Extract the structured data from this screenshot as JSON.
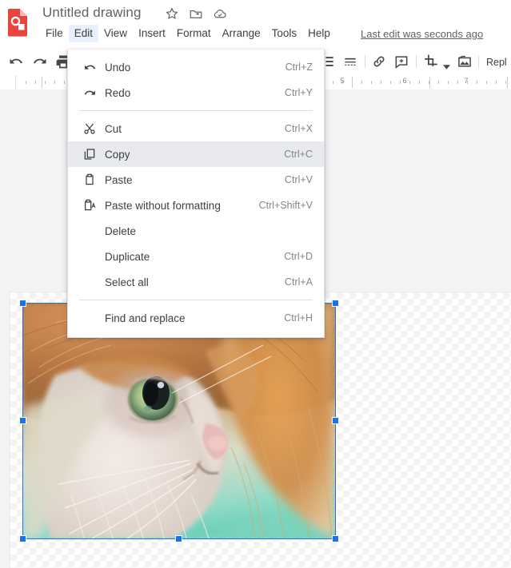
{
  "app": {
    "logo_icon": "google-drawings-logo",
    "logo_color": "#e8453c"
  },
  "header": {
    "doc_title": "Untitled drawing",
    "title_icons": [
      {
        "name": "star-icon",
        "label": "Star"
      },
      {
        "name": "move-to-folder-icon",
        "label": "Move to folder"
      },
      {
        "name": "cloud-saved-icon",
        "label": "Saved to Drive"
      }
    ],
    "menus": [
      {
        "label": "File",
        "active": false
      },
      {
        "label": "Edit",
        "active": true
      },
      {
        "label": "View",
        "active": false
      },
      {
        "label": "Insert",
        "active": false
      },
      {
        "label": "Format",
        "active": false
      },
      {
        "label": "Arrange",
        "active": false
      },
      {
        "label": "Tools",
        "active": false
      },
      {
        "label": "Help",
        "active": false
      }
    ],
    "last_edit": "Last edit was seconds ago"
  },
  "toolbar": {
    "items": [
      {
        "name": "undo-icon",
        "label": "Undo"
      },
      {
        "name": "redo-icon",
        "label": "Redo"
      },
      {
        "name": "print-icon",
        "label": "Print"
      },
      {
        "name": "list-icon",
        "label": "List options"
      },
      {
        "name": "line-dash-icon",
        "label": "Line dash"
      },
      {
        "name": "link-icon",
        "label": "Insert link"
      },
      {
        "name": "comment-icon",
        "label": "Add comment"
      },
      {
        "name": "crop-icon",
        "label": "Crop image"
      },
      {
        "name": "crop-dropdown-caret",
        "label": "Crop options"
      },
      {
        "name": "replace-image-icon",
        "label": "Replace image"
      }
    ],
    "replace_text": "Repl"
  },
  "ruler": {
    "unit_labels": [
      "5",
      "6",
      "7"
    ]
  },
  "edit_menu": {
    "groups": [
      {
        "items": [
          {
            "icon": "undo-icon",
            "label": "Undo",
            "accel": "Ctrl+Z",
            "highlighted": false
          },
          {
            "icon": "redo-icon",
            "label": "Redo",
            "accel": "Ctrl+Y",
            "highlighted": false
          }
        ]
      },
      {
        "items": [
          {
            "icon": "cut-icon",
            "label": "Cut",
            "accel": "Ctrl+X",
            "highlighted": false
          },
          {
            "icon": "copy-icon",
            "label": "Copy",
            "accel": "Ctrl+C",
            "highlighted": true
          },
          {
            "icon": "paste-icon",
            "label": "Paste",
            "accel": "Ctrl+V",
            "highlighted": false
          },
          {
            "icon": "paste-plain-icon",
            "label": "Paste without formatting",
            "accel": "Ctrl+Shift+V",
            "highlighted": false
          },
          {
            "icon": "none",
            "label": "Delete",
            "accel": "",
            "highlighted": false
          },
          {
            "icon": "none",
            "label": "Duplicate",
            "accel": "Ctrl+D",
            "highlighted": false
          },
          {
            "icon": "none",
            "label": "Select all",
            "accel": "Ctrl+A",
            "highlighted": false
          }
        ]
      },
      {
        "items": [
          {
            "icon": "none",
            "label": "Find and replace",
            "accel": "Ctrl+H",
            "highlighted": false
          }
        ]
      }
    ]
  },
  "canvas": {
    "selected_object": "cat-image",
    "selection_color": "#1a73e8",
    "handles": [
      "nw",
      "n",
      "ne",
      "w",
      "e",
      "sw",
      "s",
      "se"
    ]
  }
}
